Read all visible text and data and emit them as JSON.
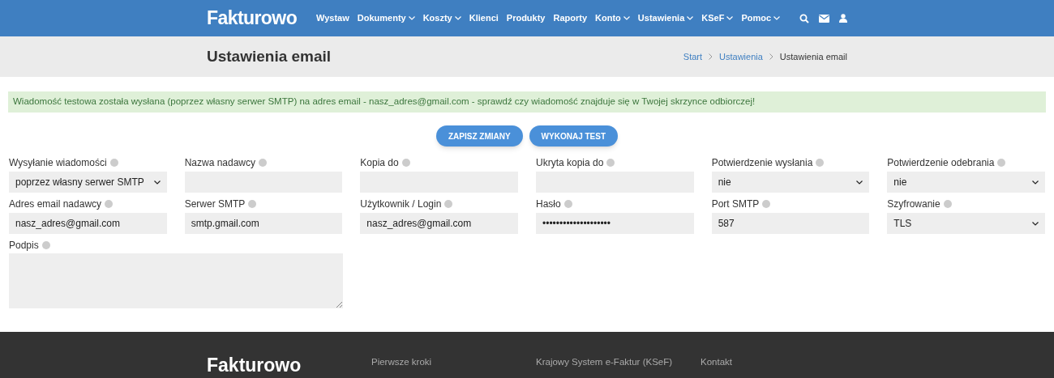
{
  "header": {
    "logo": "Fakturowo",
    "nav": [
      {
        "label": "Wystaw",
        "dropdown": false
      },
      {
        "label": "Dokumenty",
        "dropdown": true
      },
      {
        "label": "Koszty",
        "dropdown": true
      },
      {
        "label": "Klienci",
        "dropdown": false
      },
      {
        "label": "Produkty",
        "dropdown": false
      },
      {
        "label": "Raporty",
        "dropdown": false
      },
      {
        "label": "Konto",
        "dropdown": true
      },
      {
        "label": "Ustawienia",
        "dropdown": true
      },
      {
        "label": "KSeF",
        "dropdown": true
      },
      {
        "label": "Pomoc",
        "dropdown": true
      }
    ]
  },
  "page_title": "Ustawienia email",
  "breadcrumb": [
    {
      "label": "Start",
      "link": true
    },
    {
      "label": "Ustawienia",
      "link": true
    },
    {
      "label": "Ustawienia email",
      "link": false
    }
  ],
  "alert": "Wiadomość testowa została wysłana (poprzez własny serwer SMTP) na adres email - nasz_adres@gmail.com - sprawdź czy wiadomość znajduje się w Twojej skrzynce odbiorczej!",
  "buttons": [
    "ZAPISZ ZMIANY",
    "WYKONAJ TEST"
  ],
  "fields": [
    {
      "label": "Wysyłanie wiadomości",
      "kind": "select",
      "value": "poprzez własny serwer SMTP"
    },
    {
      "label": "Nazwa nadawcy",
      "kind": "input"
    },
    {
      "label": "Kopia do",
      "kind": "input"
    },
    {
      "label": "Ukryta kopia do",
      "kind": "input"
    },
    {
      "label": "Potwierdzenie wysłania",
      "kind": "select",
      "value": "nie"
    },
    {
      "label": "Potwierdzenie odebrania",
      "kind": "select",
      "value": "nie"
    },
    {
      "label": "Adres email nadawcy",
      "kind": "input",
      "value": "nasz_adres@gmail.com"
    },
    {
      "label": "Serwer SMTP",
      "kind": "input",
      "value": "smtp.gmail.com"
    },
    {
      "label": "Użytkownik / Login",
      "kind": "input",
      "value": "nasz_adres@gmail.com"
    },
    {
      "label": "Hasło",
      "kind": "input",
      "value": "••••••••••••••••••••"
    },
    {
      "label": "Port SMTP",
      "kind": "input",
      "value": "587"
    },
    {
      "label": "Szyfrowanie",
      "kind": "select",
      "value": "TLS"
    }
  ],
  "signature": {
    "label": "Podpis"
  },
  "footer": {
    "logo": "Fakturowo",
    "columns": [
      [
        "Pierwsze kroki"
      ],
      [
        "Krajowy System e-Faktur (KSeF)"
      ],
      [
        "Kontakt"
      ]
    ]
  }
}
